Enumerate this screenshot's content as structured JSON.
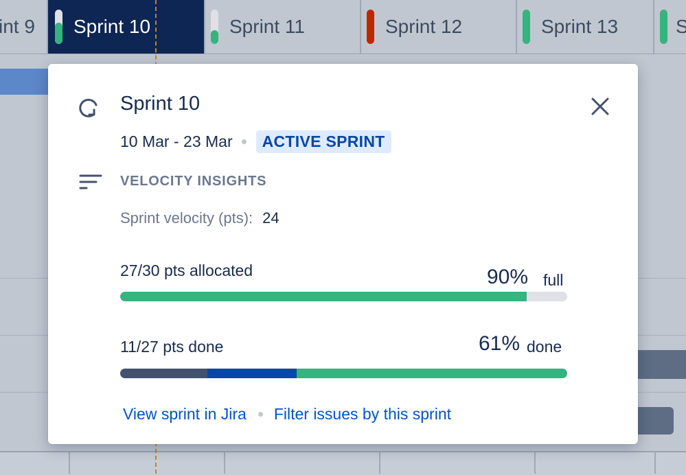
{
  "timeline": {
    "tabs": [
      {
        "label": "int 9",
        "indicator": "none",
        "indicator_color": "#c1c7d0",
        "fill": 0,
        "active": false
      },
      {
        "label": "Sprint 10",
        "indicator": "progress",
        "indicator_color": "#36b37e",
        "fill": 0.62,
        "active": true
      },
      {
        "label": "Sprint 11",
        "indicator": "progress",
        "indicator_color": "#36b37e",
        "fill": 0.4,
        "active": false
      },
      {
        "label": "Sprint 12",
        "indicator": "solid",
        "indicator_color": "#bf2600",
        "fill": 1,
        "active": false
      },
      {
        "label": "Sprint 13",
        "indicator": "solid",
        "indicator_color": "#36b37e",
        "fill": 1,
        "active": false
      },
      {
        "label": "S",
        "indicator": "solid",
        "indicator_color": "#36b37e",
        "fill": 1,
        "active": false
      }
    ]
  },
  "popup": {
    "icon": "sprint-cycle-icon",
    "title": "Sprint 10",
    "dates": "10 Mar - 23 Mar",
    "status": "ACTIVE SPRINT",
    "close_icon": "close-icon",
    "section_icon": "insights-lines-icon",
    "section_title": "VELOCITY INSIGHTS",
    "velocity_label": "Sprint velocity (pts):",
    "velocity_value": "24",
    "allocated": {
      "label": "27/30 pts allocated",
      "percent": "90%",
      "suffix": "full",
      "fill_fraction": 0.91
    },
    "done": {
      "label": "11/27 pts done",
      "percent": "61%",
      "suffix": "done",
      "segment_fractions": [
        0.195,
        0.2,
        0.605
      ]
    },
    "links": {
      "view": "View sprint in Jira",
      "filter": "Filter issues by this sprint"
    }
  },
  "colors": {
    "green": "#36b37e",
    "dark_slate": "#42526e",
    "blue": "#0747a6",
    "track": "#dfe1e6",
    "link": "#0052cc",
    "active_tab": "#0d2653"
  }
}
